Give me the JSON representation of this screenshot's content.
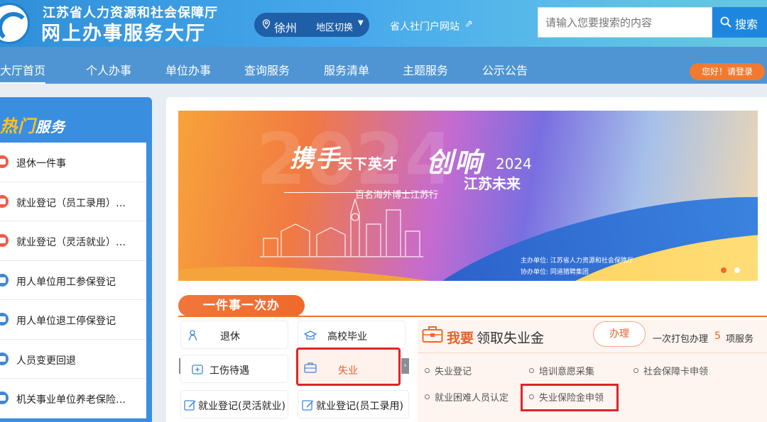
{
  "header": {
    "site_subtitle": "江苏省人力资源和社会保障厅",
    "site_title": "网上办事服务大厅",
    "location": {
      "city": "徐州",
      "switch_label": "地区切换"
    },
    "portal_link": "省人社门户网站",
    "search": {
      "placeholder": "请输入您要搜索的内容",
      "button_label": "搜索"
    }
  },
  "nav": {
    "items": [
      {
        "label": "大厅首页"
      },
      {
        "label": "个人办事"
      },
      {
        "label": "单位办事"
      },
      {
        "label": "查询服务"
      },
      {
        "label": "服务清单"
      },
      {
        "label": "主题服务"
      },
      {
        "label": "公示公告"
      }
    ],
    "login": "您好！请登录"
  },
  "sidebar": {
    "title_a": "热门",
    "title_b": "服务",
    "items": [
      {
        "label": "退休一件事"
      },
      {
        "label": "就业登记（员工录用）…"
      },
      {
        "label": "就业登记（灵活就业）…"
      },
      {
        "label": "用人单位用工参保登记"
      },
      {
        "label": "用人单位退工停保登记"
      },
      {
        "label": "人员变更回退"
      },
      {
        "label": "机关事业单位养老保险…"
      }
    ]
  },
  "banner": {
    "bg_year": "2024",
    "headline_a": "携手",
    "headline_b": "天下英才",
    "headline_c": "创响",
    "year": "2024",
    "subtitle": "江苏未来",
    "tagline": "百名海外博士江苏行",
    "organizer": "主办单位: 江苏省人力资源和社会保障厅",
    "co_organizer": "协办单位: 同道猎聘集团"
  },
  "one_thing": {
    "title": "一件事一次办",
    "services": [
      {
        "label": "退休"
      },
      {
        "label": "高校毕业"
      },
      {
        "label": "工伤待遇"
      },
      {
        "label": "失业"
      },
      {
        "label": "就业登记(灵活就业)"
      },
      {
        "label": "就业登记(员工录用)"
      }
    ],
    "panel": {
      "want": "我要",
      "want_rest": "领取失业金",
      "handle_button": "办理",
      "pack_prefix": "一次打包办理",
      "pack_count": "5",
      "pack_suffix": "项服务",
      "items": [
        {
          "label": "失业登记"
        },
        {
          "label": "培训意愿采集"
        },
        {
          "label": "社会保障卡申领"
        },
        {
          "label": "就业困难人员认定"
        },
        {
          "label": "失业保险金申领"
        }
      ]
    }
  },
  "colors": {
    "accent_orange": "#f0732e",
    "highlight_red": "#e0232a",
    "nav_blue": "#4f95d3"
  }
}
